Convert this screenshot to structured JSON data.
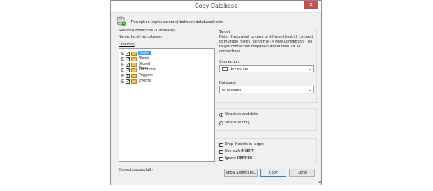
{
  "window": {
    "title": "Copy Database",
    "close_glyph": "✕"
  },
  "header": {
    "info": "This option copies object(s) between database/hosts.",
    "icon": "database-copy-icon"
  },
  "source": {
    "group_label": "Source (Connection - Database)",
    "name_line": "Name:  local - employees",
    "objects_label": "Object(s)",
    "tree": [
      {
        "label": "Tables",
        "checked": true,
        "selected": true
      },
      {
        "label": "Views",
        "checked": true,
        "selected": false
      },
      {
        "label": "Stored Procs",
        "checked": true,
        "selected": false
      },
      {
        "label": "Functions",
        "checked": true,
        "selected": false
      },
      {
        "label": "Triggers",
        "checked": true,
        "selected": false
      },
      {
        "label": "Events",
        "checked": true,
        "selected": false
      }
    ],
    "expand_glyph": "+",
    "check_glyph": "✓"
  },
  "target": {
    "group_label": "Target",
    "note": "Note: If you want to copy to different host(s), connect to multiple host(s) using  File -> New Connection. The target connection dropdown would then list all connections.",
    "connection_label": "Connection",
    "connection_value": "dev server",
    "database_label": "Database",
    "database_value": "employees",
    "caret_glyph": "⌄"
  },
  "options": {
    "structure_and_data": "Structure and data",
    "structure_only": "Structure only",
    "selected": "structure_and_data",
    "drop_if_exists": {
      "label": "Drop if exists in target",
      "checked": true
    },
    "bulk_insert": {
      "label": "Use bulk INSERT",
      "checked": true
    },
    "ignore_definer": {
      "label": "Ignore DEFINER",
      "checked": false
    }
  },
  "status": "Copied successfully",
  "buttons": {
    "show_summary": "Show Summary...",
    "copy": "Copy",
    "done": "Done"
  },
  "grip_glyph": "◢"
}
